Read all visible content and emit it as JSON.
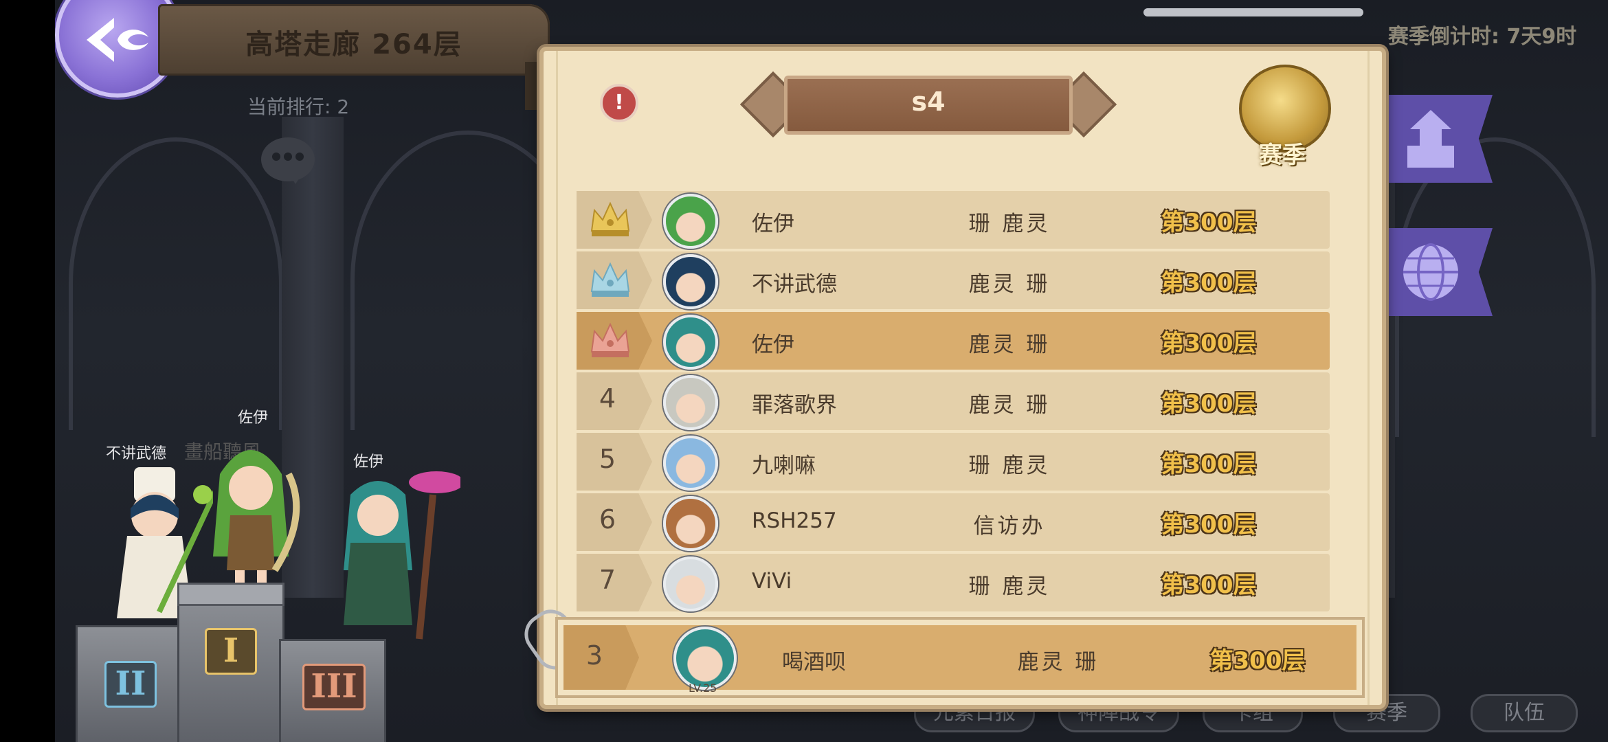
{
  "header": {
    "tower_title": "高塔走廊 264层",
    "current_rank_label": "当前排行: 2",
    "season_countdown": "赛季倒计时: 7天9时"
  },
  "podium": {
    "names": {
      "left": "不讲武德",
      "center": "佐伊",
      "right": "佐伊",
      "faint": "畫船聽風"
    },
    "places": {
      "first": "I",
      "second": "II",
      "third": "III"
    }
  },
  "panel": {
    "season_name": "s4",
    "season_badge": "赛季",
    "rows": [
      {
        "rank": "1",
        "crown": "gold",
        "name": "佐伊",
        "team": "珊 鹿灵",
        "floor": "第300层",
        "avatar_hair": "#4aa34a"
      },
      {
        "rank": "2",
        "crown": "silver",
        "name": "不讲武德",
        "team": "鹿灵 珊",
        "floor": "第300层",
        "avatar_hair": "#1f3f5f"
      },
      {
        "rank": "3",
        "crown": "bronze",
        "name": "佐伊",
        "team": "鹿灵 珊",
        "floor": "第300层",
        "avatar_hair": "#2f8f8a"
      },
      {
        "rank": "4",
        "crown": "",
        "name": "罪落歌界",
        "team": "鹿灵 珊",
        "floor": "第300层",
        "avatar_hair": "#c8c8c0"
      },
      {
        "rank": "5",
        "crown": "",
        "name": "九喇嘛",
        "team": "珊 鹿灵",
        "floor": "第300层",
        "avatar_hair": "#8ab8e0"
      },
      {
        "rank": "6",
        "crown": "",
        "name": "RSH257",
        "team": "信访办",
        "floor": "第300层",
        "avatar_hair": "#b07040"
      },
      {
        "rank": "7",
        "crown": "",
        "name": "ViVi",
        "team": "珊 鹿灵",
        "floor": "第300层",
        "avatar_hair": "#d8dde0"
      }
    ],
    "my_entry": {
      "rank": "3",
      "name": "喝酒呗",
      "team": "鹿灵 珊",
      "floor": "第300层",
      "level": "LV.25"
    }
  },
  "bottom_menu": [
    "元素日报",
    "神陣战令",
    "卡组",
    "赛季",
    "队伍"
  ],
  "icons": {
    "emblem": "swirl-emblem-icon",
    "info": "exclamation-icon",
    "chat": "chat-bubble-icon",
    "flag_top": "tower-icon",
    "flag_bottom": "globe-icon"
  },
  "colors": {
    "panel": "#f2e3c2",
    "highlight_row": "#d9ad6e",
    "floor_text": "#f1c04a",
    "flag": "#5e4fa8"
  }
}
